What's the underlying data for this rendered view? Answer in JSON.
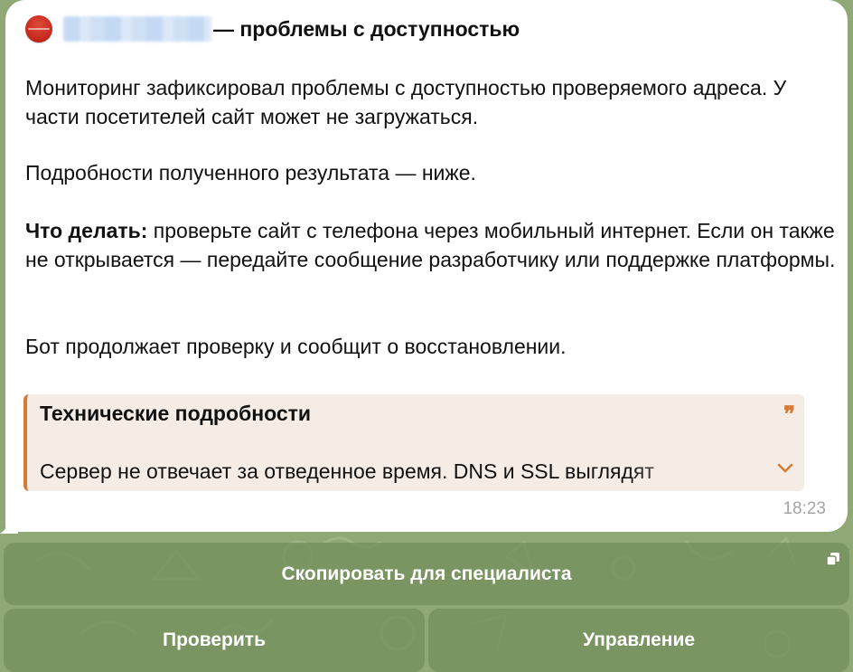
{
  "message": {
    "status_icon": "red-circle-icon",
    "title_suffix": "— проблемы с доступностью",
    "paragraph1": "Мониторинг зафиксировал проблемы с доступностью проверяемого адреса. У части посетителей сайт может не загружаться.",
    "paragraph2": "Подробности полученного результата — ниже.",
    "what_to_do_label": "Что делать:",
    "what_to_do_text": " проверьте сайт с телефона через мобильный интернет. Если он также не открывается — передайте сообщение разработчику или поддержке платформы.",
    "paragraph4": "Бот продолжает проверку и сообщит о восстановлении.",
    "quote": {
      "title": "Технические подробности",
      "mark": "❞",
      "body": "Сервер не отвечает за отведенное время. DNS и SSL выглядят"
    },
    "time": "18:23"
  },
  "keyboard": {
    "copy_label": "Скопировать для специалиста",
    "check_label": "Проверить",
    "manage_label": "Управление"
  },
  "colors": {
    "accent_orange": "#d67b35",
    "quote_background": "#f6ece6",
    "status_red": "#c92b1f",
    "wallpaper_green": "#8fa876"
  }
}
